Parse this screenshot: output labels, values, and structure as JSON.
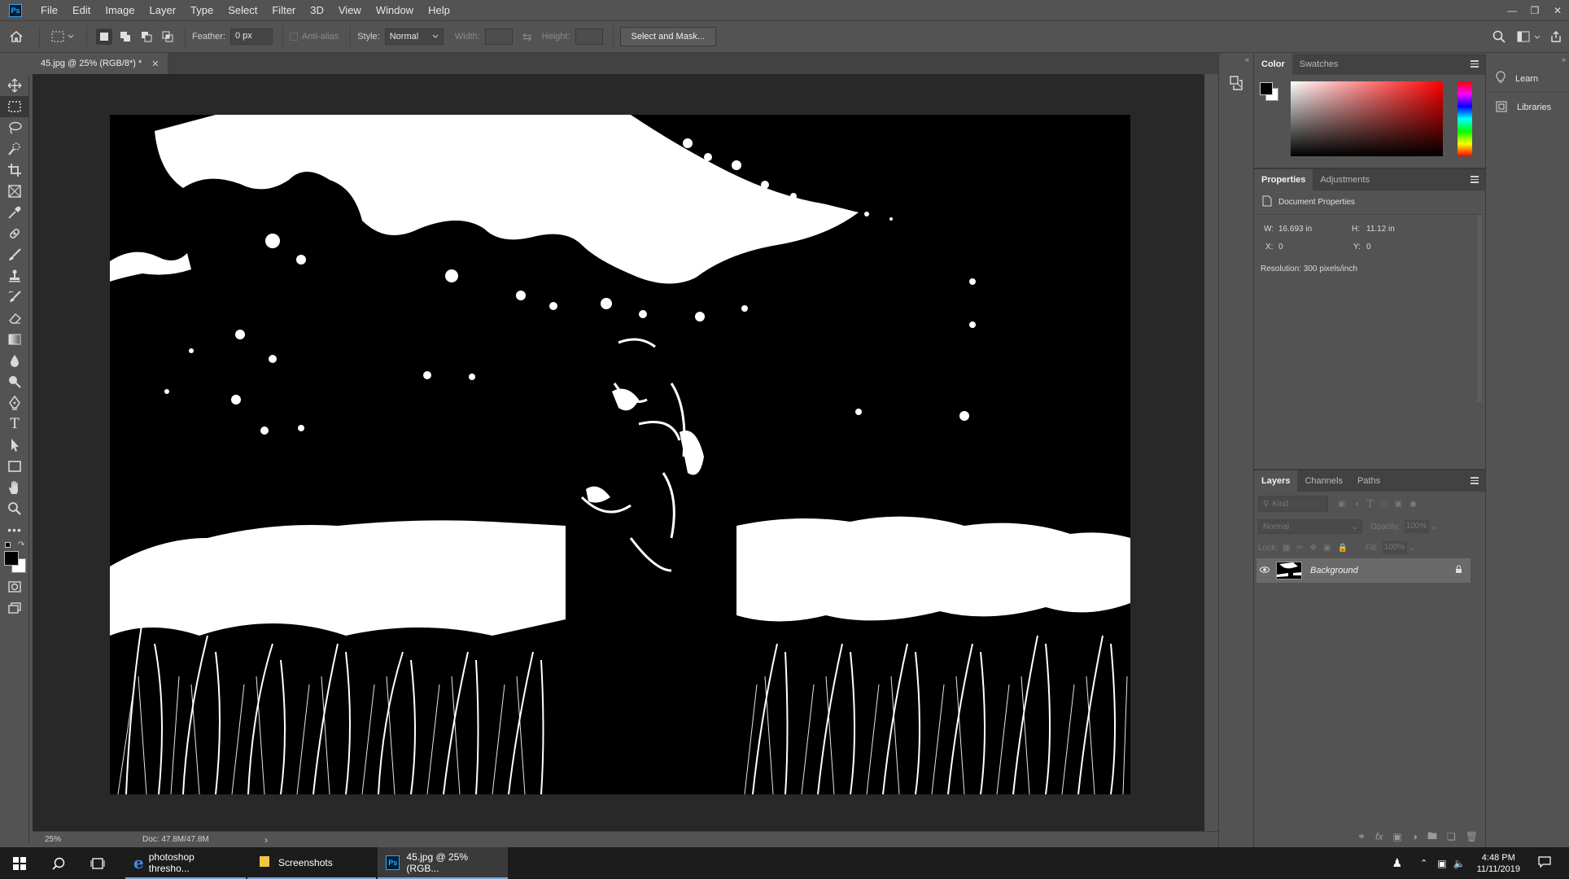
{
  "app": {
    "logo": "Ps"
  },
  "menu": [
    "File",
    "Edit",
    "Image",
    "Layer",
    "Type",
    "Select",
    "Filter",
    "3D",
    "View",
    "Window",
    "Help"
  ],
  "options": {
    "feather_label": "Feather:",
    "feather_value": "0 px",
    "antialias_label": "Anti-alias",
    "style_label": "Style:",
    "style_value": "Normal",
    "width_label": "Width:",
    "height_label": "Height:",
    "select_mask_label": "Select and Mask..."
  },
  "document": {
    "tab_title": "45.jpg @ 25% (RGB/8*) *",
    "zoom": "25%",
    "doc_size": "Doc: 47.8M/47.8M"
  },
  "color_panel": {
    "tabs": [
      "Color",
      "Swatches"
    ]
  },
  "properties_panel": {
    "tabs": [
      "Properties",
      "Adjustments"
    ],
    "header": "Document Properties",
    "w_label": "W:",
    "w_value": "16.693 in",
    "h_label": "H:",
    "h_value": "11.12 in",
    "x_label": "X:",
    "x_value": "0",
    "y_label": "Y:",
    "y_value": "0",
    "resolution": "Resolution: 300 pixels/inch"
  },
  "layers_panel": {
    "tabs": [
      "Layers",
      "Channels",
      "Paths"
    ],
    "kind_placeholder": "Kind",
    "blend_mode": "Normal",
    "opacity_label": "Opacity:",
    "opacity_value": "100%",
    "lock_label": "Lock:",
    "fill_label": "Fill:",
    "fill_value": "100%",
    "layer_name": "Background"
  },
  "far_right": {
    "learn": "Learn",
    "libraries": "Libraries"
  },
  "taskbar": {
    "apps": [
      "photoshop thresho...",
      "Screenshots",
      "45.jpg @ 25% (RGB..."
    ],
    "time": "4:48 PM",
    "date": "11/11/2019"
  },
  "colors": {
    "foreground": "#000000",
    "background": "#ffffff",
    "accent": "#31a8ff"
  }
}
